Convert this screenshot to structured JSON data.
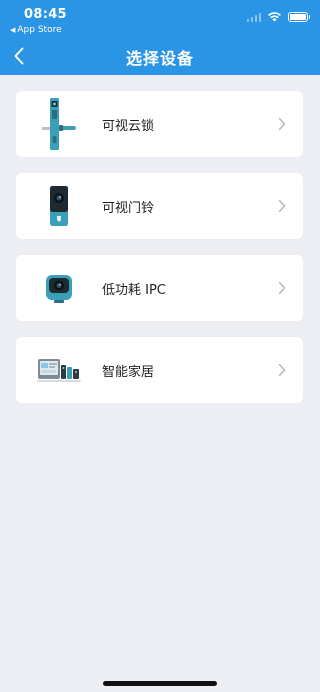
{
  "status_bar": {
    "time": "08:45",
    "back_app": "App Store"
  },
  "nav": {
    "title": "选择设备"
  },
  "devices": [
    {
      "label": "可视云锁",
      "icon": "smart-lock-icon"
    },
    {
      "label": "可视门铃",
      "icon": "doorbell-icon"
    },
    {
      "label": "低功耗 IPC",
      "icon": "camera-icon"
    },
    {
      "label": "智能家居",
      "icon": "smart-home-icon"
    }
  ],
  "colors": {
    "header": "#2a95e4",
    "background": "#eceef3",
    "card": "#ffffff",
    "device_teal": "#3aa0b8"
  }
}
